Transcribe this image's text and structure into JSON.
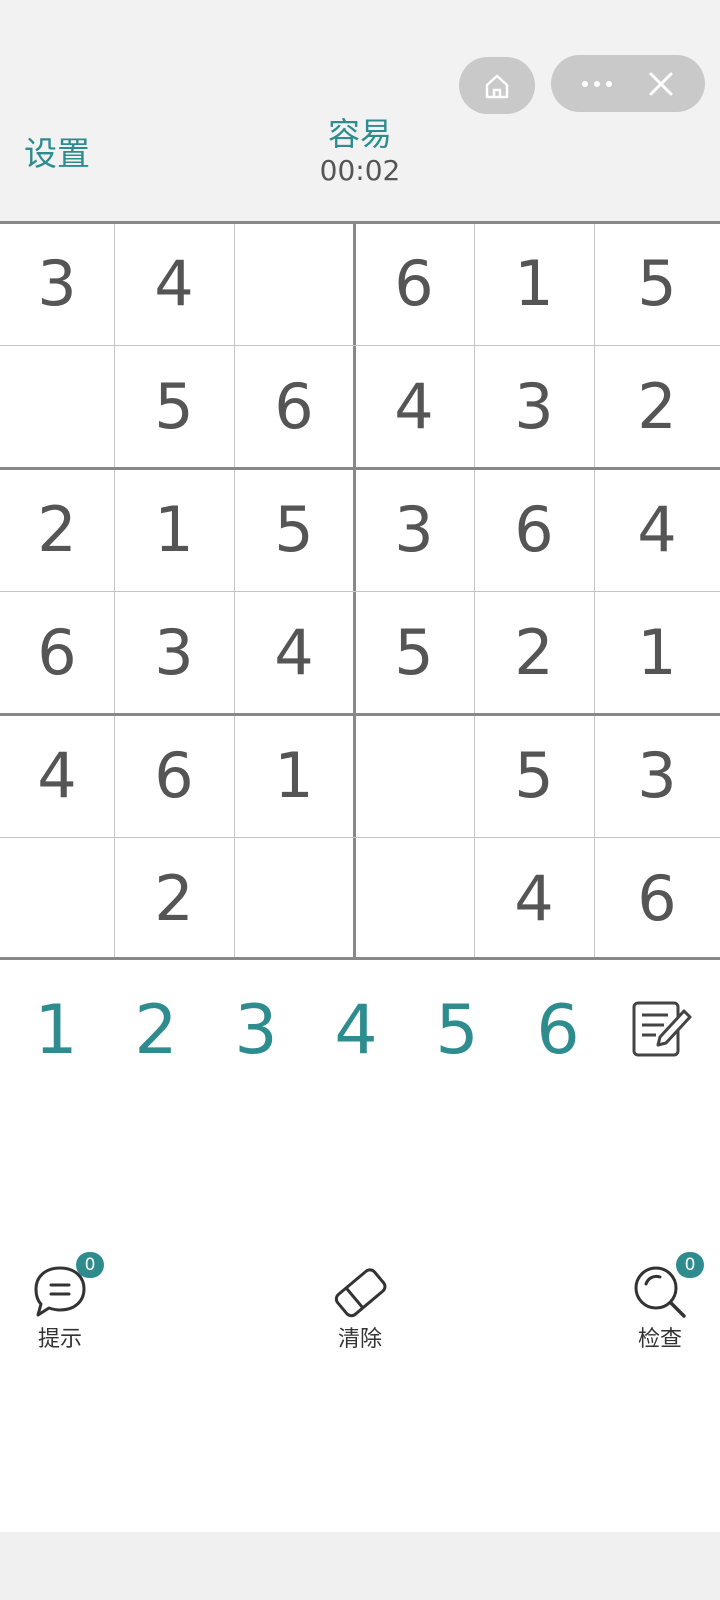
{
  "header": {
    "settings_label": "设置",
    "difficulty": "容易",
    "timer": "00:02"
  },
  "board": [
    [
      "3",
      "4",
      "",
      "6",
      "1",
      "5"
    ],
    [
      "",
      "5",
      "6",
      "4",
      "3",
      "2"
    ],
    [
      "2",
      "1",
      "5",
      "3",
      "6",
      "4"
    ],
    [
      "6",
      "3",
      "4",
      "5",
      "2",
      "1"
    ],
    [
      "4",
      "6",
      "1",
      "",
      "5",
      "3"
    ],
    [
      "",
      "2",
      "",
      "",
      "4",
      "6"
    ]
  ],
  "numpad": [
    "1",
    "2",
    "3",
    "4",
    "5",
    "6"
  ],
  "actions": {
    "hint": {
      "label": "提示",
      "count": "0",
      "icon": "hint-bubble-icon"
    },
    "clear": {
      "label": "清除",
      "icon": "eraser-icon"
    },
    "check": {
      "label": "检查",
      "count": "0",
      "icon": "magnifier-icon"
    }
  },
  "colors": {
    "accent": "#2e8c8f",
    "text": "#555555",
    "header_bg": "#f2f2f2"
  }
}
